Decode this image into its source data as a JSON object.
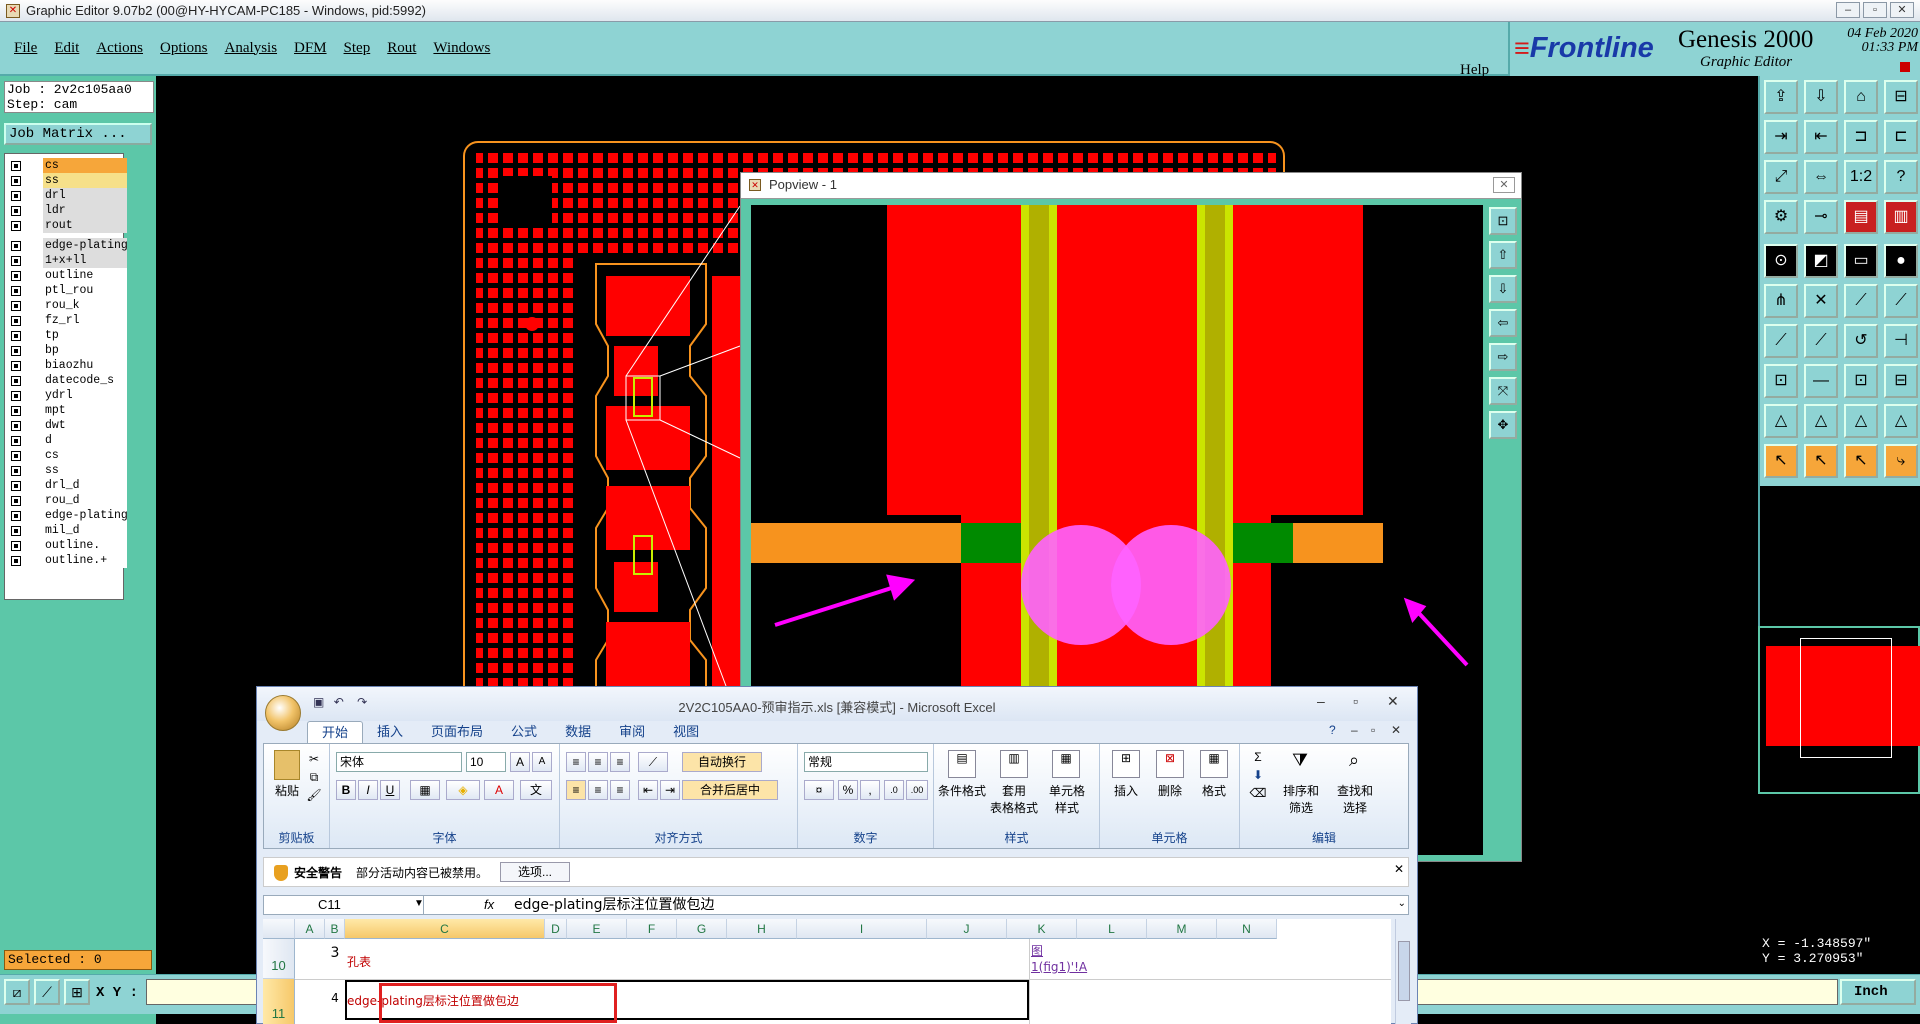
{
  "window": {
    "title": "Graphic Editor 9.07b2 (00@HY-HYCAM-PC185 - Windows, pid:5992)",
    "controls": [
      "–",
      "▫",
      "✕"
    ]
  },
  "menu": {
    "items": [
      "File",
      "Edit",
      "Actions",
      "Options",
      "Analysis",
      "DFM",
      "Step",
      "Rout",
      "Windows"
    ],
    "help": "Help"
  },
  "brand": {
    "logo": "Frontline",
    "product": "Genesis 2000",
    "subtitle": "Graphic Editor",
    "date": "04 Feb 2020",
    "time": "01:33 PM"
  },
  "job": {
    "job_label": "Job : 2v2c105aa0",
    "step_label": "Step: cam",
    "matrix_button": "Job Matrix ..."
  },
  "layers": [
    "cs",
    "ss",
    "drl",
    "ldr",
    "rout",
    "edge-plating",
    "1+x+ll",
    "outline",
    "ptl_rou",
    "rou_k",
    "fz_rl",
    "tp",
    "bp",
    "biaozhu",
    "datecode_s",
    "ydrl",
    "mpt",
    "dwt",
    "d",
    "cs",
    "ss",
    "drl_d",
    "rou_d",
    "edge-plating",
    "mil_d",
    "outline.",
    "outline.+"
  ],
  "status": {
    "selected": "Selected : 0",
    "xy_label": "X Y :",
    "xy_value": "",
    "units": "Inch"
  },
  "coords": {
    "x": "X = -1.348597\"",
    "y": "Y = 3.270953\""
  },
  "colors": {
    "teal": "#8ed3d3",
    "panel_green": "#5cc7a8",
    "copper_red": "#ff0000",
    "outline_orange": "#f7931e",
    "drill_magenta": "#ff00ff",
    "yellow_green": "#c8f000",
    "pad_green": "#008a00",
    "arrow_magenta": "#ff00ff"
  },
  "popview": {
    "title": "Popview - 1"
  },
  "excel": {
    "title": "2V2C105AA0-预审指示.xls  [兼容模式] - Microsoft Excel",
    "tabs": [
      "开始",
      "插入",
      "页面布局",
      "公式",
      "数据",
      "审阅",
      "视图"
    ],
    "clipboard": {
      "paste": "粘贴",
      "group": "剪贴板"
    },
    "font": {
      "name": "宋体",
      "size": "10",
      "group": "字体"
    },
    "alignment": {
      "wrap": "自动换行",
      "merge": "合并后居中",
      "group": "对齐方式"
    },
    "number": {
      "format": "常规",
      "group": "数字"
    },
    "styles": {
      "cond": "条件格式",
      "table": "套用\n表格格式",
      "cell": "单元格\n样式",
      "group": "样式"
    },
    "cells": {
      "insert": "插入",
      "delete": "删除",
      "format": "格式",
      "group": "单元格"
    },
    "editing": {
      "sort": "排序和\n筛选",
      "find": "查找和\n选择",
      "group": "编辑"
    },
    "security": {
      "label": "安全警告",
      "message": "部分活动内容已被禁用。",
      "options": "选项..."
    },
    "name_box": "C11",
    "formula": "edge-plating层标注位置做包边",
    "columns": [
      "A",
      "B",
      "C",
      "D",
      "E",
      "F",
      "G",
      "H",
      "I",
      "J",
      "K",
      "L",
      "M",
      "N"
    ],
    "rows": [
      {
        "num": "10",
        "b": "3",
        "c": "孔表",
        "j": "图\n1(fig1)'!A"
      },
      {
        "num": "11",
        "b": "4",
        "c": "edge-plating层标注位置做包边",
        "j": ""
      }
    ]
  }
}
